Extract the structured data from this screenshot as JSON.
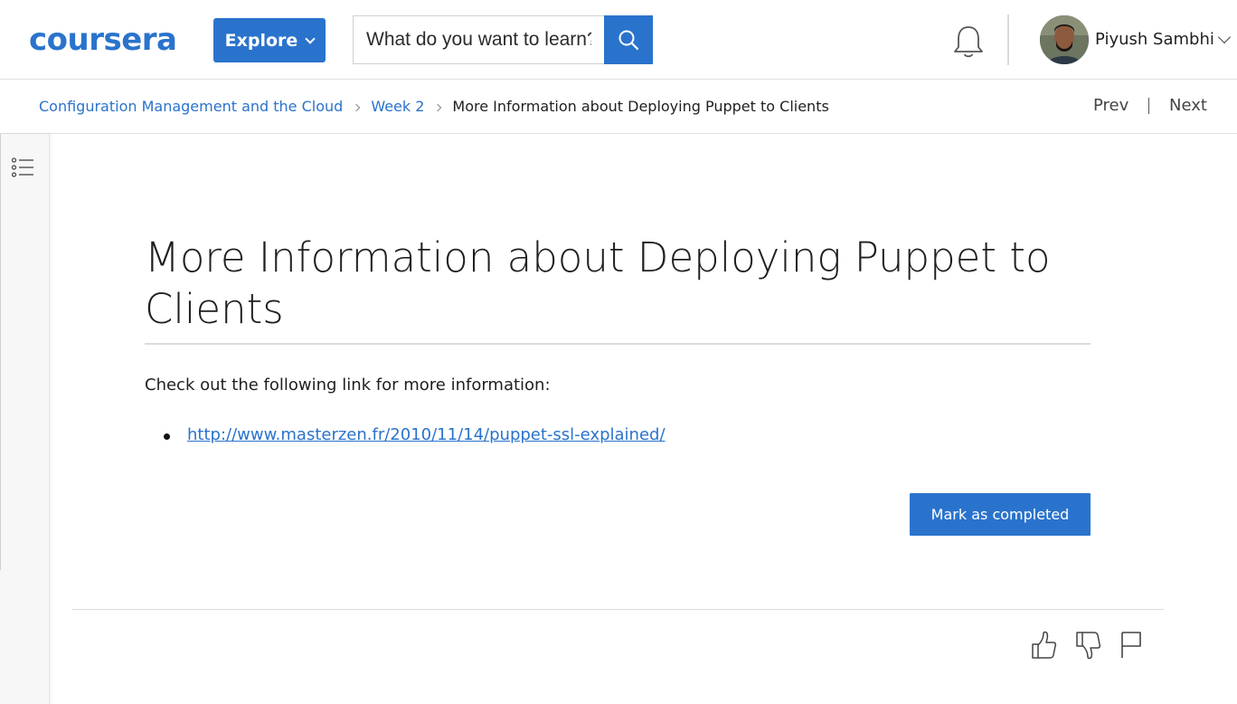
{
  "header": {
    "logo_text": "coursera",
    "explore_label": "Explore",
    "search_placeholder": "What do you want to learn?",
    "user_name": "Piyush Sambhi"
  },
  "breadcrumb": {
    "items": [
      {
        "label": "Configuration Management and the Cloud"
      },
      {
        "label": "Week 2"
      },
      {
        "label": "More Information about Deploying Puppet to Clients"
      }
    ],
    "prev_label": "Prev",
    "next_label": "Next"
  },
  "content": {
    "title": "More Information about Deploying Puppet to Clients",
    "intro": "Check out the following link for more information:",
    "links": [
      {
        "text": "http://www.masterzen.fr/2010/11/14/puppet-ssl-explained/"
      }
    ],
    "complete_label": "Mark as completed"
  },
  "icons": {
    "search": "search-icon",
    "notifications": "bell-icon",
    "outline": "list-outline-icon",
    "like": "thumbs-up-icon",
    "dislike": "thumbs-down-icon",
    "report": "flag-icon"
  },
  "colors": {
    "brand": "#2a73cc",
    "text": "#1f1f1f",
    "rail_bg": "#f7f7f7"
  }
}
